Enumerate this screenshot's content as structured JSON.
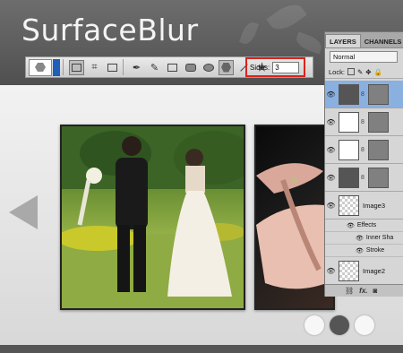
{
  "site": {
    "title": "SurfaceBlur",
    "slide_count": 3,
    "active_slide": 2
  },
  "options_bar": {
    "sides_label": "Sides:",
    "sides_value": "3",
    "highlight_color": "#d9241c"
  },
  "layers_panel": {
    "tabs": [
      "LAYERS",
      "CHANNELS"
    ],
    "blend_mode": "Normal",
    "lock_label": "Lock:",
    "layers": [
      {
        "name": "",
        "thumb": "dark",
        "selected": true
      },
      {
        "name": "",
        "thumb": "white",
        "selected": false
      },
      {
        "name": "",
        "thumb": "white",
        "selected": false
      },
      {
        "name": "",
        "thumb": "dark",
        "selected": false
      },
      {
        "name": "Image3",
        "thumb": "checker",
        "selected": false
      },
      {
        "name": "Image2",
        "thumb": "checker",
        "selected": false
      }
    ],
    "effects_label": "Effects",
    "effects": [
      "Inner Sha",
      "Stroke"
    ],
    "bottom_icons": [
      "link-icon",
      "fx-icon",
      "mask-icon"
    ],
    "bottom_fx": "fx."
  },
  "colors": {
    "selection": "#8ab0e0",
    "header_bg": "#5c5c5c"
  }
}
